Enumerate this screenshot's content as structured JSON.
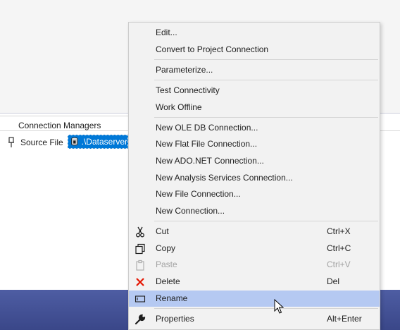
{
  "connection_managers": {
    "tab_label": "Connection Managers",
    "items": [
      {
        "label": "Source File",
        "icon": "pin-icon"
      },
      {
        "label": ".\\Dataserver",
        "icon": "database-icon",
        "selected": true
      }
    ]
  },
  "context_menu": {
    "items": [
      {
        "label": "Edit..."
      },
      {
        "label": "Convert to Project Connection"
      },
      {
        "label": "Parameterize..."
      },
      {
        "label": "Test Connectivity"
      },
      {
        "label": "Work Offline"
      },
      {
        "label": "New OLE DB Connection..."
      },
      {
        "label": "New Flat File Connection..."
      },
      {
        "label": "New ADO.NET Connection..."
      },
      {
        "label": "New Analysis Services Connection..."
      },
      {
        "label": "New File Connection..."
      },
      {
        "label": "New Connection..."
      },
      {
        "label": "Cut",
        "shortcut": "Ctrl+X",
        "icon": "scissors-icon"
      },
      {
        "label": "Copy",
        "shortcut": "Ctrl+C",
        "icon": "copy-icon"
      },
      {
        "label": "Paste",
        "shortcut": "Ctrl+V",
        "icon": "paste-icon",
        "disabled": true
      },
      {
        "label": "Delete",
        "shortcut": "Del",
        "icon": "delete-x-icon"
      },
      {
        "label": "Rename",
        "icon": "rename-icon",
        "highlighted": true
      },
      {
        "label": "Properties",
        "shortcut": "Alt+Enter",
        "icon": "wrench-icon"
      }
    ]
  },
  "colors": {
    "selection_blue": "#0078d7",
    "menu_highlight": "#b5c9f2",
    "status_bar": "#3c4b8f",
    "delete_red": "#e51400"
  }
}
